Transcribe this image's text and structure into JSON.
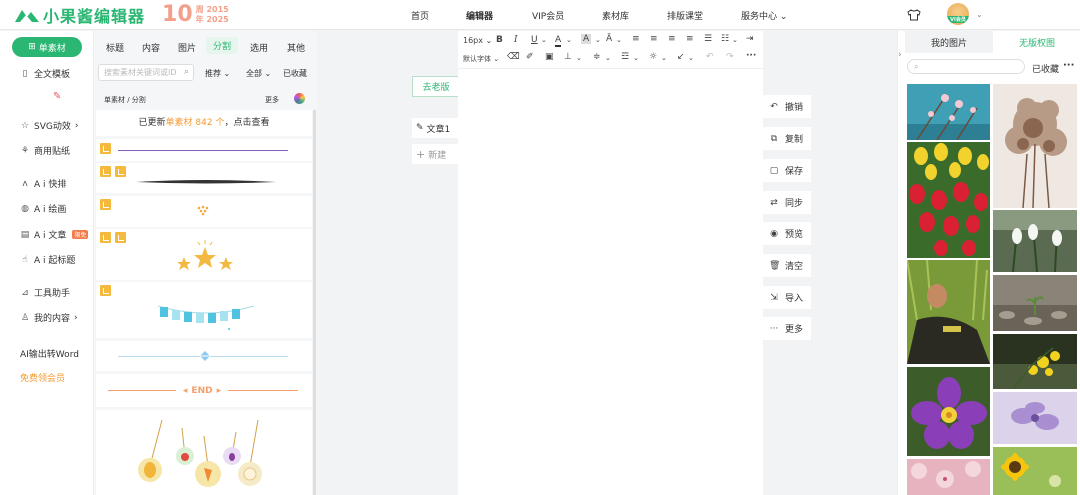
{
  "brand": {
    "name": "小果酱编辑器",
    "anniversary_num": "10",
    "anniversary_word_1": "周",
    "anniversary_year_1": "2015",
    "anniversary_word_2": "年",
    "anniversary_year_2": "2025"
  },
  "nav": {
    "items": [
      "首页",
      "编辑器",
      "VIP会员",
      "素材库",
      "排版课堂",
      "服务中心"
    ],
    "active": "编辑器"
  },
  "user": {
    "avatar_tag": "VI会员"
  },
  "sidebar": {
    "primary_button": "单素材",
    "items": [
      {
        "label": "全文模板",
        "icon": "grid-icon"
      },
      {
        "label": "SVG动效",
        "icon": "star-icon",
        "arrow": "›"
      },
      {
        "label": "商用贴纸",
        "icon": "puzzle-icon"
      },
      {
        "label": "A i 快排",
        "icon": "ai-icon"
      },
      {
        "label": "A i 绘画",
        "icon": "palette-icon"
      },
      {
        "label": "A i 文章",
        "icon": "document-icon",
        "badge": "限免"
      },
      {
        "label": "A i 起标题",
        "icon": "hand-icon"
      },
      {
        "label": "工具助手",
        "icon": "ruler-icon"
      },
      {
        "label": "我的内容",
        "icon": "user-icon",
        "arrow": "›"
      },
      {
        "label": "AI输出转Word",
        "icon": ""
      }
    ],
    "vip_link": "免费领会员"
  },
  "material_panel": {
    "tabs": [
      "标题",
      "内容",
      "图片",
      "分割",
      "选用",
      "其他"
    ],
    "active_tab": "分割",
    "search_placeholder": "搜索素材关键词或ID",
    "filters": {
      "recommend": "推荐",
      "all": "全部",
      "favorites": "已收藏"
    },
    "breadcrumb": "单素材 / 分割",
    "more": "更多",
    "update_prefix": "已更新",
    "update_highlight": "单素材 842 个",
    "update_suffix": "，点击查看",
    "end_text": "END"
  },
  "workspace": {
    "old_version": "去老版",
    "doc_tab": "文章1",
    "new_doc": "新建"
  },
  "toolbar": {
    "font_size": "16px",
    "font_family": "默认字体"
  },
  "actions": [
    {
      "label": "撤销",
      "icon": "undo-icon"
    },
    {
      "label": "复制",
      "icon": "copy-icon"
    },
    {
      "label": "保存",
      "icon": "save-icon"
    },
    {
      "label": "同步",
      "icon": "sync-icon"
    },
    {
      "label": "预览",
      "icon": "eye-icon"
    },
    {
      "label": "清空",
      "icon": "trash-icon"
    },
    {
      "label": "导入",
      "icon": "import-icon"
    },
    {
      "label": "更多",
      "icon": "more-icon"
    }
  ],
  "right_panel": {
    "tabs": [
      "我的图片",
      "无版权图"
    ],
    "active_tab": "我的图片",
    "favorites": "已收藏",
    "photos_left": [
      "blossoms-sky",
      "tulips",
      "man-in-grass",
      "purple-flower",
      "pink-blossoms"
    ],
    "photos_right": [
      "dried-flowers",
      "snowdrops",
      "pebbles-sprout",
      "yellow-flowers",
      "lilac-flowers",
      "sunflower"
    ]
  },
  "colors": {
    "accent": "#2bb673",
    "orange": "#f39a35",
    "anniversary": "#f3a08a"
  }
}
